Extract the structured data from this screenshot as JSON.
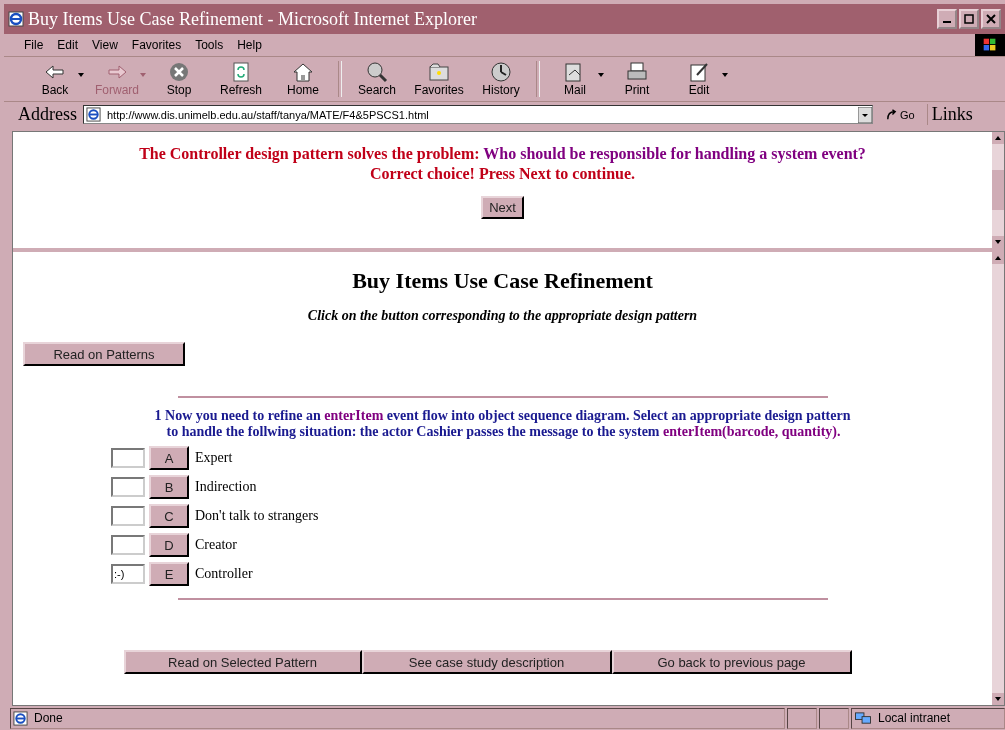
{
  "window": {
    "title": "Buy Items Use Case Refinement - Microsoft Internet Explorer"
  },
  "menu": [
    "File",
    "Edit",
    "View",
    "Favorites",
    "Tools",
    "Help"
  ],
  "toolbar": [
    {
      "label": "Back",
      "kind": "back",
      "disabled": false,
      "dropdown": true
    },
    {
      "label": "Forward",
      "kind": "forward",
      "disabled": true,
      "dropdown": true
    },
    {
      "label": "Stop",
      "kind": "stop",
      "disabled": false,
      "dropdown": false
    },
    {
      "label": "Refresh",
      "kind": "refresh",
      "disabled": false,
      "dropdown": false
    },
    {
      "label": "Home",
      "kind": "home",
      "disabled": false,
      "dropdown": false
    },
    {
      "label": "Search",
      "kind": "search",
      "disabled": false,
      "dropdown": false
    },
    {
      "label": "Favorites",
      "kind": "favorites",
      "disabled": false,
      "dropdown": false
    },
    {
      "label": "History",
      "kind": "history",
      "disabled": false,
      "dropdown": false
    },
    {
      "label": "Mail",
      "kind": "mail",
      "disabled": false,
      "dropdown": true
    },
    {
      "label": "Print",
      "kind": "print",
      "disabled": false,
      "dropdown": false
    },
    {
      "label": "Edit",
      "kind": "edit",
      "disabled": false,
      "dropdown": true
    }
  ],
  "address": {
    "label": "Address",
    "url": "http://www.dis.unimelb.edu.au/staff/tanya/MATE/F4&5PSCS1.html",
    "go": "Go",
    "links": "Links"
  },
  "feedback": {
    "lines": [
      [
        {
          "text": "The Controller design pattern solves the problem:",
          "kind": "result"
        },
        {
          "text": "Who should be responsible for handling a system event?",
          "kind": "problem"
        }
      ],
      [
        {
          "text": "Correct choice! Press Next to continue.",
          "kind": "result"
        }
      ]
    ],
    "button": "Next"
  },
  "page": {
    "heading": "Buy Items Use Case Refinement",
    "instruction": "Click on the button corresponding to the appropriate design pattern",
    "read_button": "Read on Patterns",
    "question": {
      "number": "1",
      "lines": [
        [
          {
            "text": "Now you need to refine an",
            "kind": "plain"
          },
          {
            "text": "enterItem",
            "kind": "code"
          },
          {
            "text": "event flow into object sequence diagram. Select an appropriate design pattern",
            "kind": "plain"
          }
        ],
        [
          {
            "text": "to handle the follwing situation: the actor Cashier passes the message to the system",
            "kind": "plain"
          },
          {
            "text": "enterItem(barcode, quantity).",
            "kind": "code"
          }
        ]
      ]
    },
    "options": [
      {
        "letter": "A",
        "label": "Expert"
      },
      {
        "letter": "B",
        "label": "Indirection"
      },
      {
        "letter": "C",
        "label": "Don't talk to strangers"
      },
      {
        "letter": "D",
        "label": "Creator"
      },
      {
        "letter": "E",
        "label": "Controller",
        "answer": ":-)"
      }
    ],
    "bottom_buttons": [
      "Read on Selected Pattern",
      "See case study description",
      "Go back to previous page"
    ]
  },
  "status_bar": {
    "text": "Done",
    "zone": "Local intranet"
  }
}
